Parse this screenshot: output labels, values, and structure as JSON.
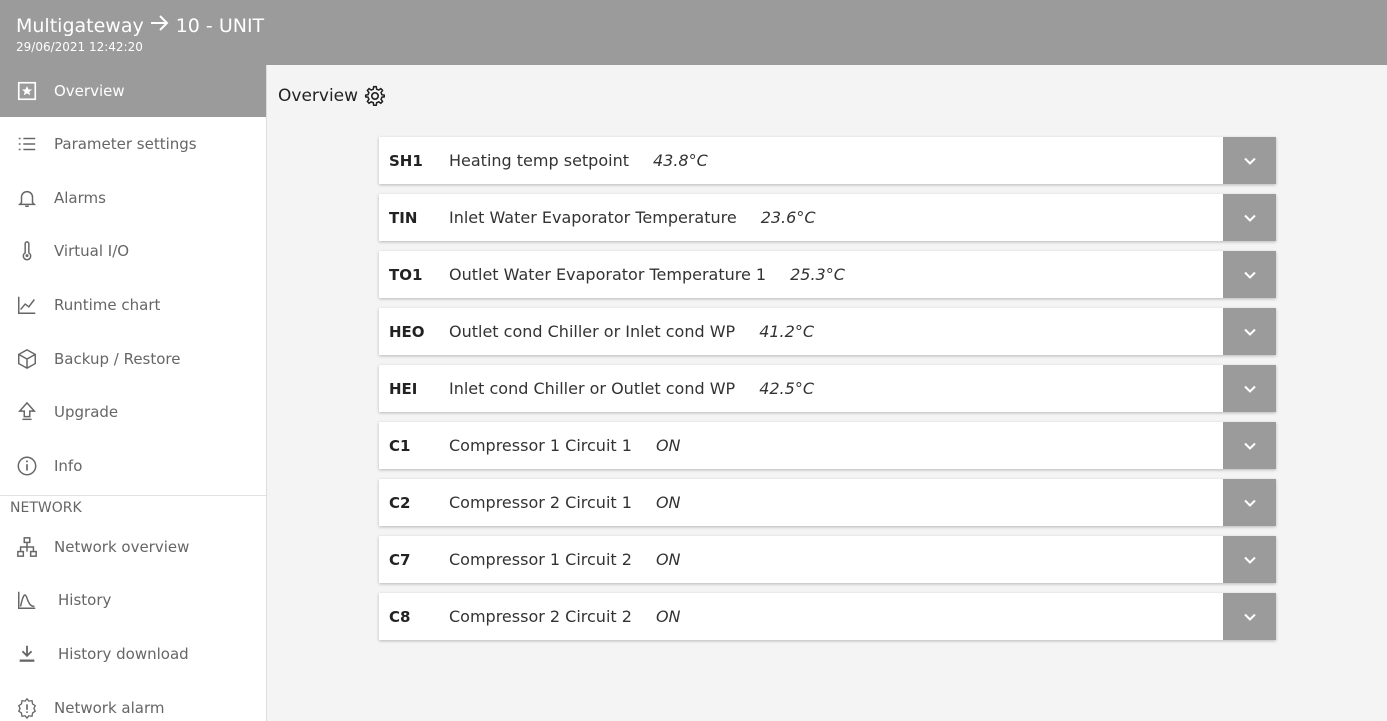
{
  "header": {
    "device": "Multigateway",
    "unit": "10 - UNIT",
    "timestamp": "29/06/2021 12:42:20"
  },
  "sidebar": {
    "items": [
      {
        "label": "Overview",
        "icon": "star-icon",
        "active": true
      },
      {
        "label": "Parameter settings",
        "icon": "list-icon"
      },
      {
        "label": "Alarms",
        "icon": "bell-icon"
      },
      {
        "label": "Virtual I/O",
        "icon": "thermometer-icon"
      },
      {
        "label": "Runtime chart",
        "icon": "line-chart-icon"
      },
      {
        "label": "Backup / Restore",
        "icon": "box-icon"
      },
      {
        "label": "Upgrade",
        "icon": "upload-arrow-icon"
      },
      {
        "label": "Info",
        "icon": "info-icon"
      }
    ],
    "network_section_label": "NETWORK",
    "network_items": [
      {
        "label": "Network overview",
        "icon": "network-icon"
      },
      {
        "label": "History",
        "icon": "history-chart-icon"
      },
      {
        "label": "History download",
        "icon": "download-icon"
      },
      {
        "label": "Network alarm",
        "icon": "alarm-gear-icon"
      }
    ]
  },
  "main": {
    "title": "Overview",
    "rows": [
      {
        "code": "SH1",
        "description": "Heating temp setpoint",
        "value": "43.8°C"
      },
      {
        "code": "TIN",
        "description": "Inlet Water Evaporator Temperature",
        "value": "23.6°C"
      },
      {
        "code": "TO1",
        "description": "Outlet Water Evaporator Temperature 1",
        "value": "25.3°C"
      },
      {
        "code": "HEO",
        "description": "Outlet cond Chiller or Inlet cond WP",
        "value": "41.2°C"
      },
      {
        "code": "HEI",
        "description": "Inlet cond Chiller or Outlet cond WP",
        "value": "42.5°C"
      },
      {
        "code": "C1",
        "description": "Compressor 1 Circuit 1",
        "value": "ON"
      },
      {
        "code": "C2",
        "description": "Compressor 2 Circuit 1",
        "value": "ON"
      },
      {
        "code": "C7",
        "description": "Compressor 1 Circuit 2",
        "value": "ON"
      },
      {
        "code": "C8",
        "description": "Compressor 2 Circuit 2",
        "value": "ON"
      }
    ]
  },
  "colors": {
    "header_bg": "#9b9b9b",
    "active_bg": "#9b9b9b",
    "expand_bg": "#9b9b9b"
  }
}
